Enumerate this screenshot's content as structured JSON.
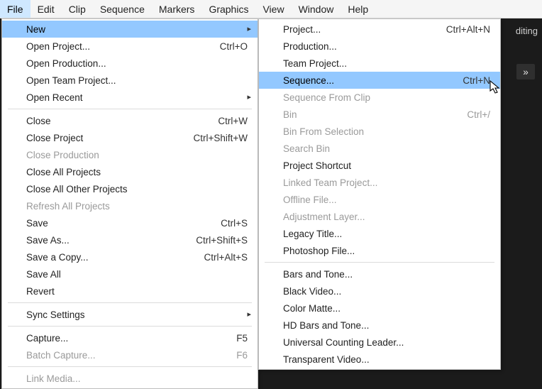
{
  "menubar": {
    "items": [
      "File",
      "Edit",
      "Clip",
      "Sequence",
      "Markers",
      "Graphics",
      "View",
      "Window",
      "Help"
    ],
    "active_index": 0
  },
  "file_menu": {
    "rows": [
      {
        "label": "New",
        "submenu": true,
        "highlight": true
      },
      {
        "label": "Open Project...",
        "shortcut": "Ctrl+O"
      },
      {
        "label": "Open Production..."
      },
      {
        "label": "Open Team Project..."
      },
      {
        "label": "Open Recent",
        "submenu": true
      },
      {
        "sep": true
      },
      {
        "label": "Close",
        "shortcut": "Ctrl+W"
      },
      {
        "label": "Close Project",
        "shortcut": "Ctrl+Shift+W"
      },
      {
        "label": "Close Production",
        "disabled": true
      },
      {
        "label": "Close All Projects"
      },
      {
        "label": "Close All Other Projects"
      },
      {
        "label": "Refresh All Projects",
        "disabled": true
      },
      {
        "label": "Save",
        "shortcut": "Ctrl+S"
      },
      {
        "label": "Save As...",
        "shortcut": "Ctrl+Shift+S"
      },
      {
        "label": "Save a Copy...",
        "shortcut": "Ctrl+Alt+S"
      },
      {
        "label": "Save All"
      },
      {
        "label": "Revert"
      },
      {
        "sep": true
      },
      {
        "label": "Sync Settings",
        "submenu": true
      },
      {
        "sep": true
      },
      {
        "label": "Capture...",
        "shortcut": "F5"
      },
      {
        "label": "Batch Capture...",
        "shortcut": "F6",
        "disabled": true
      },
      {
        "sep": true
      },
      {
        "label": "Link Media...",
        "disabled": true
      }
    ]
  },
  "new_submenu": {
    "rows": [
      {
        "label": "Project...",
        "shortcut": "Ctrl+Alt+N"
      },
      {
        "label": "Production..."
      },
      {
        "label": "Team Project..."
      },
      {
        "label": "Sequence...",
        "shortcut": "Ctrl+N",
        "highlight": true
      },
      {
        "label": "Sequence From Clip",
        "disabled": true
      },
      {
        "label": "Bin",
        "shortcut": "Ctrl+/",
        "disabled": true
      },
      {
        "label": "Bin From Selection",
        "disabled": true
      },
      {
        "label": "Search Bin",
        "disabled": true
      },
      {
        "label": "Project Shortcut"
      },
      {
        "label": "Linked Team Project...",
        "disabled": true
      },
      {
        "label": "Offline File...",
        "disabled": true
      },
      {
        "label": "Adjustment Layer...",
        "disabled": true
      },
      {
        "label": "Legacy Title..."
      },
      {
        "label": "Photoshop File..."
      },
      {
        "sep": true
      },
      {
        "label": "Bars and Tone..."
      },
      {
        "label": "Black Video..."
      },
      {
        "label": "Color Matte..."
      },
      {
        "label": "HD Bars and Tone..."
      },
      {
        "label": "Universal Counting Leader..."
      },
      {
        "label": "Transparent Video..."
      }
    ]
  },
  "background": {
    "tab_text": "diting",
    "expand_glyph": "»"
  },
  "arrow_glyph": "▸"
}
